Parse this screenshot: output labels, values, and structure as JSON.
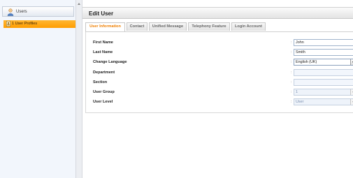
{
  "sidebar": {
    "title": "Users",
    "items": [
      {
        "label": "1 User Profiles",
        "selected": true
      }
    ]
  },
  "main": {
    "title": "Edit User",
    "tabs": [
      {
        "label": "User Information",
        "active": true
      },
      {
        "label": "Contact",
        "active": false
      },
      {
        "label": "Unified Message",
        "active": false
      },
      {
        "label": "Telephony Feature",
        "active": false
      },
      {
        "label": "Login Account",
        "active": false
      }
    ],
    "form": {
      "first_name": {
        "label": "First Name",
        "value": "John"
      },
      "last_name": {
        "label": "Last Name",
        "value": "Smith"
      },
      "change_language": {
        "label": "Change Language",
        "value": "English (UK)"
      },
      "department": {
        "label": "Department",
        "value": ""
      },
      "section": {
        "label": "Section",
        "value": ""
      },
      "user_group": {
        "label": "User Group",
        "value": "1"
      },
      "user_level": {
        "label": "User Level",
        "value": "User"
      }
    },
    "separator": ":"
  },
  "colors": {
    "accent": "#ff9d00",
    "active_tab_text": "#ef7f00",
    "sidebar_bg": "#f2f6fc"
  }
}
